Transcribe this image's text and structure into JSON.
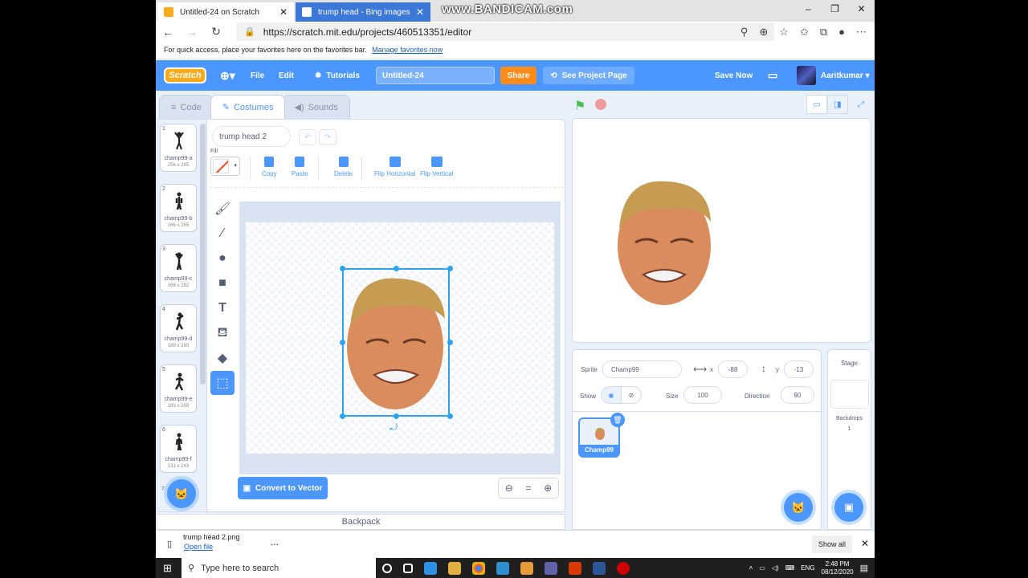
{
  "browser": {
    "tabs": [
      {
        "label": "Untitled-24 on Scratch"
      },
      {
        "label": "trump head - Bing images"
      }
    ],
    "watermark": "www.BANDICAM.com",
    "url": "https://scratch.mit.edu/projects/460513351/editor",
    "favbar_text": "For quick access, place your favorites here on the favorites bar.",
    "favbar_link": "Manage favorites now"
  },
  "menu": {
    "logo": "Scratch",
    "file": "File",
    "edit": "Edit",
    "tutorials": "Tutorials",
    "project_title": "Untitled-24",
    "share": "Share",
    "see_project": "See Project Page",
    "save_now": "Save Now",
    "username": "Aaritkumar"
  },
  "editor": {
    "tabs": {
      "code": "Code",
      "costumes": "Costumes",
      "sounds": "Sounds"
    },
    "costume_name": "trump head 2",
    "fill_label": "Fill",
    "toolbar": {
      "copy": "Copy",
      "paste": "Paste",
      "delete": "Delete",
      "flip_h": "Flip Horizontal",
      "flip_v": "Flip Vertical"
    },
    "convert": "Convert to Vector",
    "zoom_eq": "=",
    "backpack": "Backpack"
  },
  "costumes": [
    {
      "num": "1",
      "name": "champ99-a",
      "size": "256 x 285"
    },
    {
      "num": "2",
      "name": "champ99-b",
      "size": "166 x 265"
    },
    {
      "num": "3",
      "name": "champ99-c",
      "size": "168 x 282"
    },
    {
      "num": "4",
      "name": "champ99-d",
      "size": "189 x 280"
    },
    {
      "num": "5",
      "name": "champ99-e",
      "size": "193 x 259"
    },
    {
      "num": "6",
      "name": "champ99-f",
      "size": "131 x 243"
    },
    {
      "num": "7",
      "name": "",
      "size": ""
    }
  ],
  "sprite": {
    "label": "Sprite",
    "name": "Champ99",
    "x_label": "x",
    "x": "-88",
    "y_label": "y",
    "y": "-13",
    "show_label": "Show",
    "size_label": "Size",
    "size": "100",
    "direction_label": "Direction",
    "direction": "90",
    "tile_name": "Champ99"
  },
  "stage_panel": {
    "title": "Stage",
    "backdrops_label": "Backdrops",
    "backdrops_count": "1"
  },
  "download": {
    "filename": "trump head 2.png",
    "open_file": "Open file",
    "more": "...",
    "show_all": "Show all"
  },
  "taskbar": {
    "search_placeholder": "Type here to search",
    "lang": "ENG",
    "time": "2:48 PM",
    "date": "08/12/2020"
  },
  "colors": {
    "scratch_blue": "#4c97ff",
    "share_orange": "#ff8c1a",
    "selection": "#2ea3f2"
  }
}
